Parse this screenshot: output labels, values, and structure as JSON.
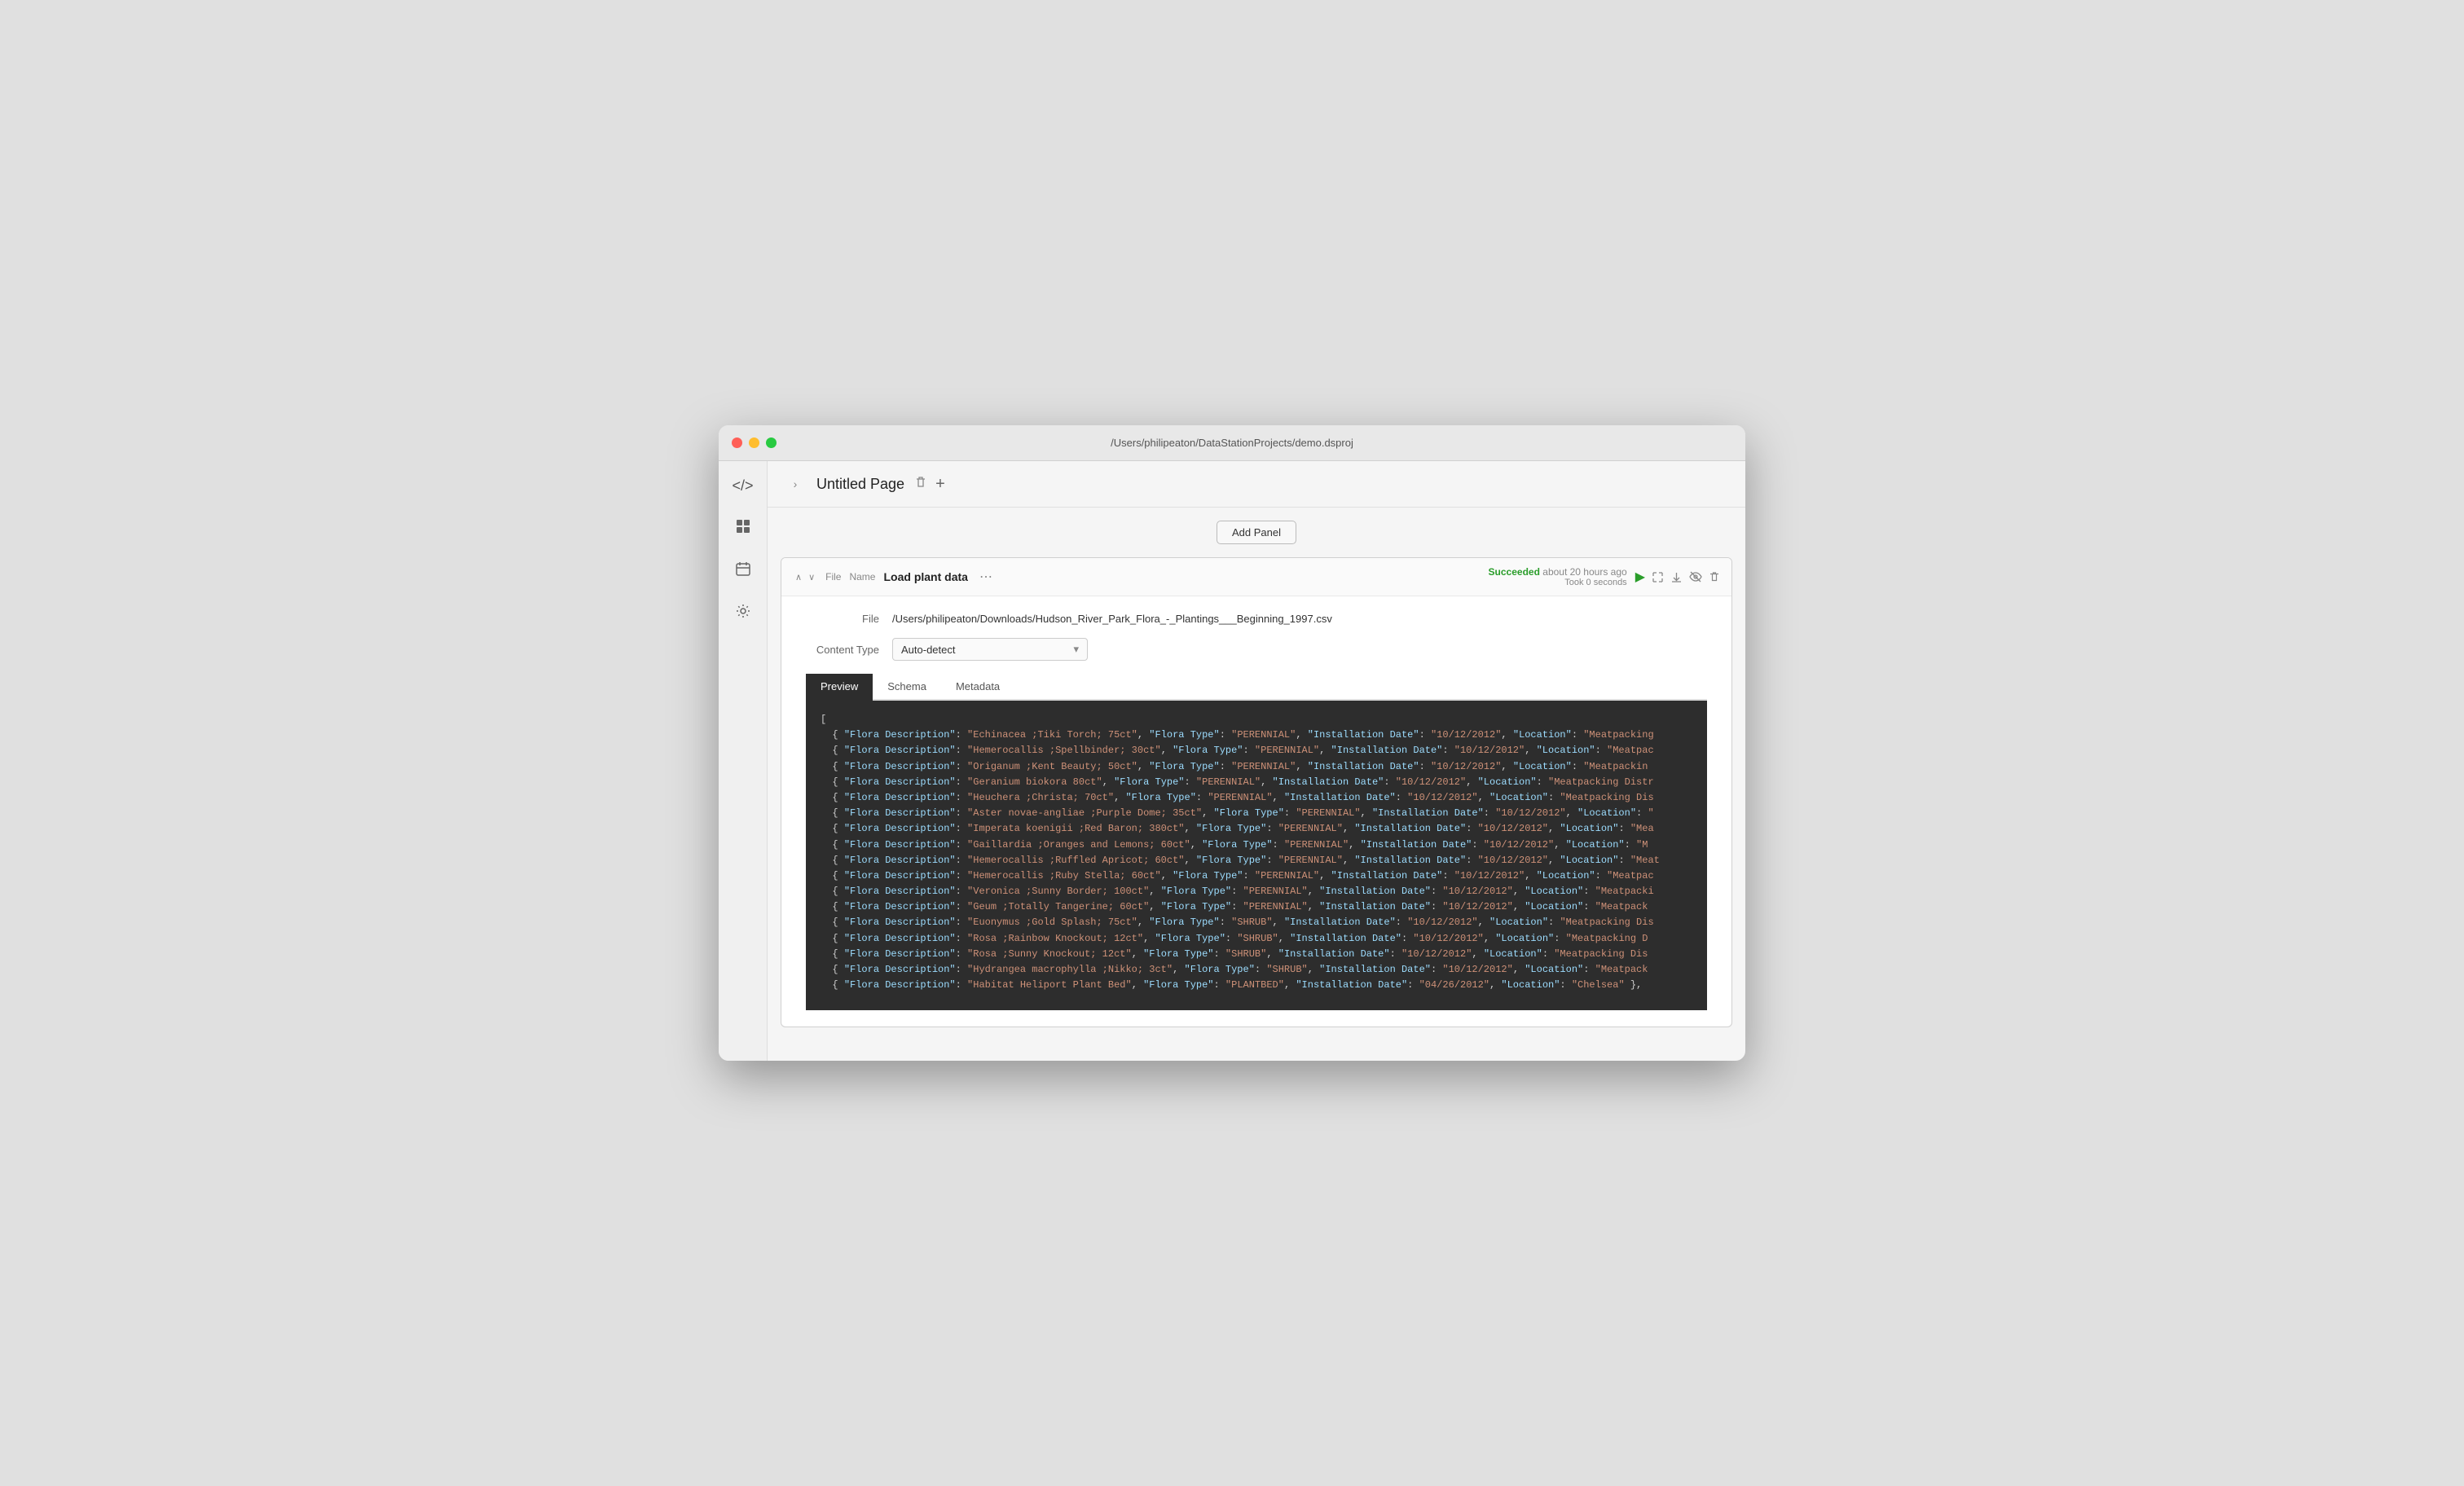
{
  "window": {
    "title": "/Users/philipeaton/DataStationProjects/demo.dsproj"
  },
  "sidebar": {
    "icons": [
      {
        "name": "code-icon",
        "symbol": "</>"
      },
      {
        "name": "grid-icon",
        "symbol": "⊞"
      },
      {
        "name": "calendar-icon",
        "symbol": "📅"
      },
      {
        "name": "settings-icon",
        "symbol": "⚙"
      }
    ],
    "chevron": "›"
  },
  "page": {
    "title": "Untitled Page",
    "delete_label": "🗑",
    "add_label": "+"
  },
  "add_panel": {
    "label": "Add Panel"
  },
  "panel": {
    "type_label": "File",
    "name_label": "Name",
    "title": "Load plant data",
    "status": {
      "result": "Succeeded",
      "time": "about 20 hours ago",
      "took": "Took 0 seconds"
    },
    "file_label": "File",
    "file_value": "/Users/philipeaton/Downloads/Hudson_River_Park_Flora_-_Plantings___Beginning_1997.csv",
    "content_type_label": "Content Type",
    "content_type_value": "Auto-detect"
  },
  "tabs": [
    {
      "label": "Preview",
      "active": true
    },
    {
      "label": "Schema",
      "active": false
    },
    {
      "label": "Metadata",
      "active": false
    }
  ],
  "preview": {
    "rows": [
      "  { \"Flora Description\": \"Echinacea ;Tiki Torch;  75ct\", \"Flora Type\": \"PERENNIAL\", \"Installation Date\": \"10/12/2012\", \"Location\": \"Meatpacking",
      "  { \"Flora Description\": \"Hemerocallis ;Spellbinder;  30ct\", \"Flora Type\": \"PERENNIAL\", \"Installation Date\": \"10/12/2012\", \"Location\": \"Meatpac",
      "  { \"Flora Description\": \"Origanum ;Kent Beauty;   50ct\", \"Flora Type\": \"PERENNIAL\", \"Installation Date\": \"10/12/2012\", \"Location\": \"Meatpackin",
      "  { \"Flora Description\": \"Geranium biokora  80ct\", \"Flora Type\": \"PERENNIAL\", \"Installation Date\": \"10/12/2012\", \"Location\": \"Meatpacking Distr",
      "  { \"Flora Description\": \"Heuchera ;Christa;  70ct\", \"Flora Type\": \"PERENNIAL\", \"Installation Date\": \"10/12/2012\", \"Location\": \"Meatpacking Dis",
      "  { \"Flora Description\": \"Aster novae-angliae ;Purple Dome;  35ct\", \"Flora Type\": \"PERENNIAL\", \"Installation Date\": \"10/12/2012\", \"Location\": \"",
      "  { \"Flora Description\": \"Imperata koenigii ;Red Baron;  380ct\", \"Flora Type\": \"PERENNIAL\", \"Installation Date\": \"10/12/2012\", \"Location\": \"Mea",
      "  { \"Flora Description\": \"Gaillardia ;Oranges and Lemons;   60ct\", \"Flora Type\": \"PERENNIAL\", \"Installation Date\": \"10/12/2012\", \"Location\": \"M",
      "  { \"Flora Description\": \"Hemerocallis ;Ruffled Apricot; 60ct\", \"Flora Type\": \"PERENNIAL\", \"Installation Date\": \"10/12/2012\", \"Location\": \"Meat",
      "  { \"Flora Description\": \"Hemerocallis ;Ruby Stella;  60ct\", \"Flora Type\": \"PERENNIAL\", \"Installation Date\": \"10/12/2012\", \"Location\": \"Meatpac",
      "  { \"Flora Description\": \"Veronica ;Sunny Border;  100ct\", \"Flora Type\": \"PERENNIAL\", \"Installation Date\": \"10/12/2012\", \"Location\": \"Meatpacki",
      "  { \"Flora Description\": \"Geum ;Totally Tangerine;   60ct\", \"Flora Type\": \"PERENNIAL\", \"Installation Date\": \"10/12/2012\", \"Location\": \"Meatpack",
      "  { \"Flora Description\": \"Euonymus ;Gold Splash;  75ct\", \"Flora Type\": \"SHRUB\", \"Installation Date\": \"10/12/2012\", \"Location\": \"Meatpacking Dis",
      "  { \"Flora Description\": \"Rosa ;Rainbow Knockout;   12ct\", \"Flora Type\": \"SHRUB\", \"Installation Date\": \"10/12/2012\", \"Location\": \"Meatpacking D",
      "  { \"Flora Description\": \"Rosa ;Sunny Knockout;   12ct\", \"Flora Type\": \"SHRUB\", \"Installation Date\": \"10/12/2012\", \"Location\": \"Meatpacking Dis",
      "  { \"Flora Description\": \"Hydrangea macrophylla ;Nikko;   3ct\", \"Flora Type\": \"SHRUB\", \"Installation Date\": \"10/12/2012\", \"Location\": \"Meatpack",
      "  { \"Flora Description\": \"Habitat Heliport Plant Bed\", \"Flora Type\": \"PLANTBED\", \"Installation Date\": \"04/26/2012\", \"Location\": \"Chelsea\" },"
    ]
  },
  "colors": {
    "success": "#2a9d2a",
    "accent": "#2d2d2d"
  }
}
